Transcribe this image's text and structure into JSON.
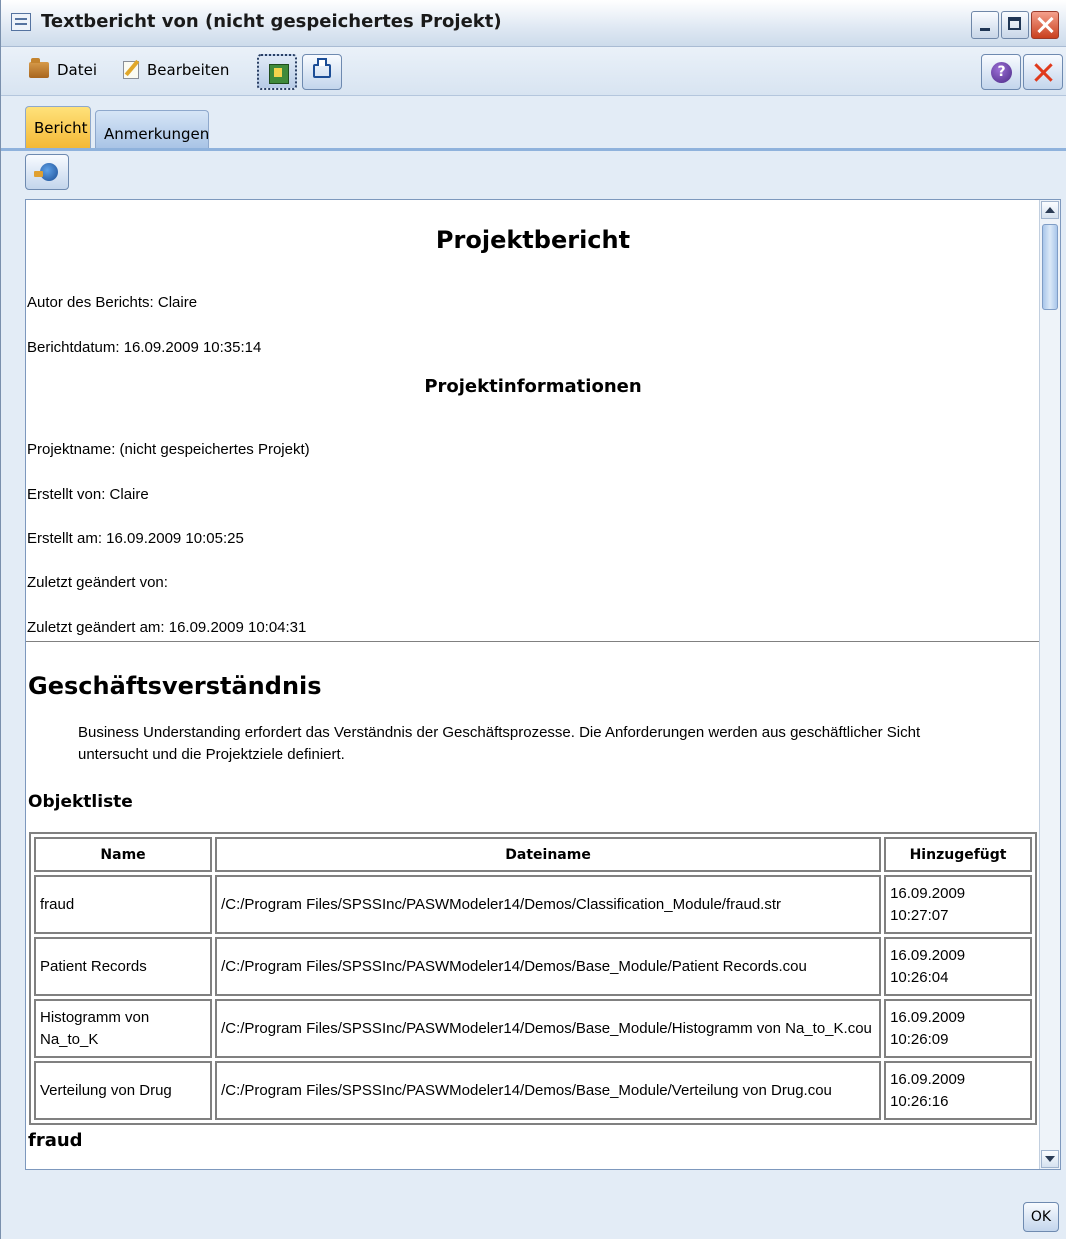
{
  "window": {
    "title": "Textbericht von (nicht gespeichertes Projekt)"
  },
  "menu": {
    "datei": "Datei",
    "bearbeiten": "Bearbeiten"
  },
  "tabs": [
    {
      "label": "Bericht",
      "active": true
    },
    {
      "label": "Anmerkungen",
      "active": false
    }
  ],
  "report": {
    "title": "Projektbericht",
    "author": "Autor des Berichts: Claire",
    "date": "Berichtdatum: 16.09.2009 10:35:14",
    "info_heading": "Projektinformationen",
    "project_name": "Projektname: (nicht gespeichertes Projekt)",
    "created_by": "Erstellt von: Claire",
    "created_on": "Erstellt am: 16.09.2009 10:05:25",
    "modified_by": "Zuletzt geändert von:",
    "modified_on": "Zuletzt geändert am: 16.09.2009 10:04:31",
    "section_title": "Geschäftsverständnis",
    "section_description": "Business Understanding erfordert das Verständnis der Geschäftsprozesse. Die Anforderungen werden aus geschäftlicher Sicht untersucht und die Projektziele definiert.",
    "object_list_title": "Objektliste",
    "table": {
      "headers": [
        "Name",
        "Dateiname",
        "Hinzugefügt"
      ],
      "rows": [
        {
          "name": "fraud",
          "file": "/C:/Program Files/SPSSInc/PASWModeler14/Demos/Classification_Module/fraud.str",
          "added": "16.09.2009 10:27:07"
        },
        {
          "name": "Patient Records",
          "file": "/C:/Program Files/SPSSInc/PASWModeler14/Demos/Base_Module/Patient Records.cou",
          "added": "16.09.2009 10:26:04"
        },
        {
          "name": "Histogramm von Na_to_K",
          "file": "/C:/Program Files/SPSSInc/PASWModeler14/Demos/Base_Module/Histogramm von Na_to_K.cou",
          "added": "16.09.2009 10:26:09"
        },
        {
          "name": "Verteilung von Drug",
          "file": "/C:/Program Files/SPSSInc/PASWModeler14/Demos/Base_Module/Verteilung von Drug.cou",
          "added": "16.09.2009 10:26:16"
        }
      ]
    },
    "next_section": "fraud"
  },
  "buttons": {
    "ok": "OK",
    "help_symbol": "?"
  },
  "icons": {
    "title": "report-window-icon",
    "datei": "folder-icon",
    "bearbeiten": "edit-icon",
    "export": "export-icon",
    "print": "print-icon",
    "help": "help-icon",
    "close": "close-icon",
    "globe": "globe-export-icon"
  },
  "colors": {
    "active_tab": "#f4b936",
    "inactive_tab": "#a9c4e6",
    "window_background": "#e3ecf6"
  }
}
